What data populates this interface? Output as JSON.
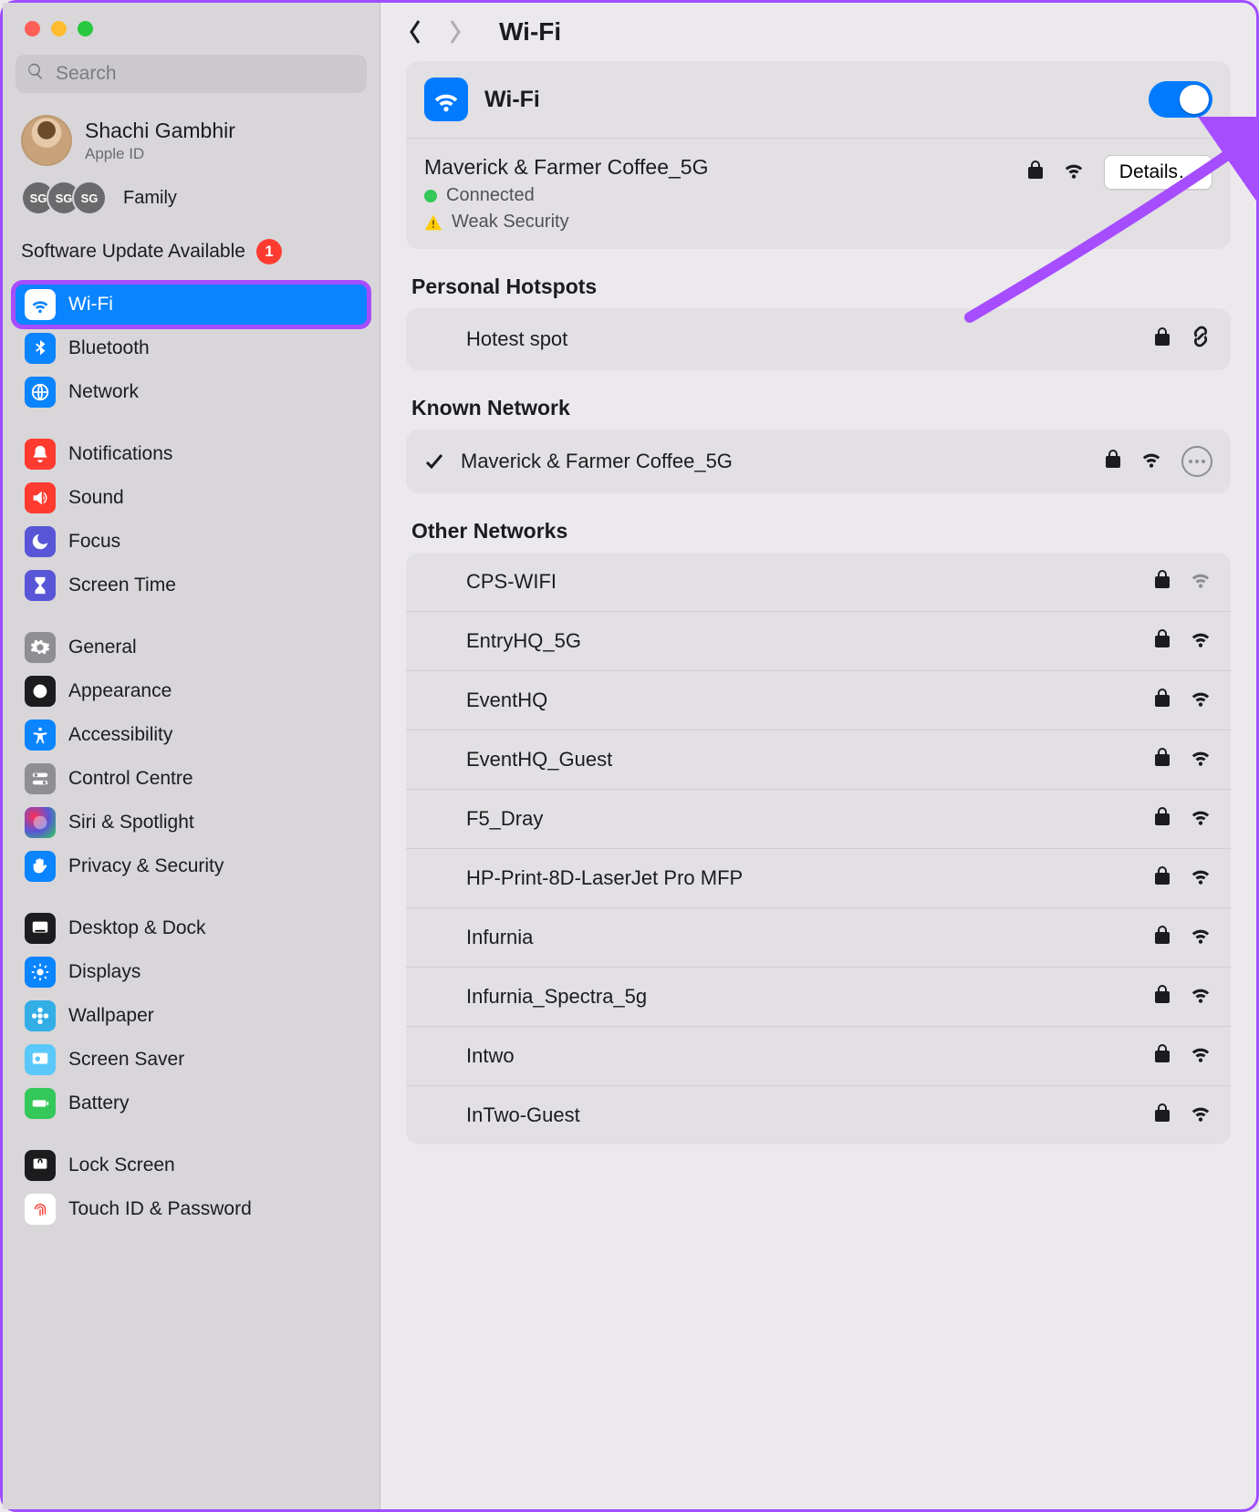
{
  "search": {
    "placeholder": "Search"
  },
  "account": {
    "name": "Shachi Gambhir",
    "sub": "Apple ID"
  },
  "family": {
    "label": "Family",
    "tags": [
      "SG",
      "SG",
      "SG"
    ]
  },
  "software_update": {
    "label": "Software Update Available",
    "count": "1"
  },
  "sidebar": {
    "groups": [
      {
        "items": [
          {
            "id": "wifi",
            "label": "Wi-Fi"
          },
          {
            "id": "bluetooth",
            "label": "Bluetooth"
          },
          {
            "id": "network",
            "label": "Network"
          }
        ]
      },
      {
        "items": [
          {
            "id": "notifications",
            "label": "Notifications"
          },
          {
            "id": "sound",
            "label": "Sound"
          },
          {
            "id": "focus",
            "label": "Focus"
          },
          {
            "id": "screentime",
            "label": "Screen Time"
          }
        ]
      },
      {
        "items": [
          {
            "id": "general",
            "label": "General"
          },
          {
            "id": "appearance",
            "label": "Appearance"
          },
          {
            "id": "accessibility",
            "label": "Accessibility"
          },
          {
            "id": "controlcentre",
            "label": "Control Centre"
          },
          {
            "id": "siri",
            "label": "Siri & Spotlight"
          },
          {
            "id": "privacy",
            "label": "Privacy & Security"
          }
        ]
      },
      {
        "items": [
          {
            "id": "desktopdock",
            "label": "Desktop & Dock"
          },
          {
            "id": "displays",
            "label": "Displays"
          },
          {
            "id": "wallpaper",
            "label": "Wallpaper"
          },
          {
            "id": "screensaver",
            "label": "Screen Saver"
          },
          {
            "id": "battery",
            "label": "Battery"
          }
        ]
      },
      {
        "items": [
          {
            "id": "lockscreen",
            "label": "Lock Screen"
          },
          {
            "id": "touchid",
            "label": "Touch ID & Password"
          }
        ]
      }
    ]
  },
  "header": {
    "title": "Wi-Fi"
  },
  "wifi_toggle": {
    "label": "Wi-Fi",
    "on": true
  },
  "current": {
    "ssid": "Maverick & Farmer Coffee_5G",
    "status": "Connected",
    "security_warning": "Weak Security",
    "details_label": "Details…"
  },
  "sections": {
    "hotspots_title": "Personal Hotspots",
    "known_title": "Known Network",
    "other_title": "Other Networks"
  },
  "hotspots": [
    {
      "ssid": "Hotest spot",
      "locked": true,
      "link": true
    }
  ],
  "known": [
    {
      "ssid": "Maverick & Farmer Coffee_5G",
      "locked": true,
      "strong": true,
      "connected": true
    }
  ],
  "other": [
    {
      "ssid": "CPS-WIFI",
      "locked": true,
      "strong": false
    },
    {
      "ssid": "EntryHQ_5G",
      "locked": true,
      "strong": true
    },
    {
      "ssid": "EventHQ",
      "locked": true,
      "strong": true
    },
    {
      "ssid": "EventHQ_Guest",
      "locked": true,
      "strong": true
    },
    {
      "ssid": "F5_Dray",
      "locked": true,
      "strong": true
    },
    {
      "ssid": "HP-Print-8D-LaserJet Pro MFP",
      "locked": true,
      "strong": true
    },
    {
      "ssid": "Infurnia",
      "locked": true,
      "strong": true
    },
    {
      "ssid": "Infurnia_Spectra_5g",
      "locked": true,
      "strong": true
    },
    {
      "ssid": "Intwo",
      "locked": true,
      "strong": true
    },
    {
      "ssid": "InTwo-Guest",
      "locked": true,
      "strong": true
    }
  ]
}
